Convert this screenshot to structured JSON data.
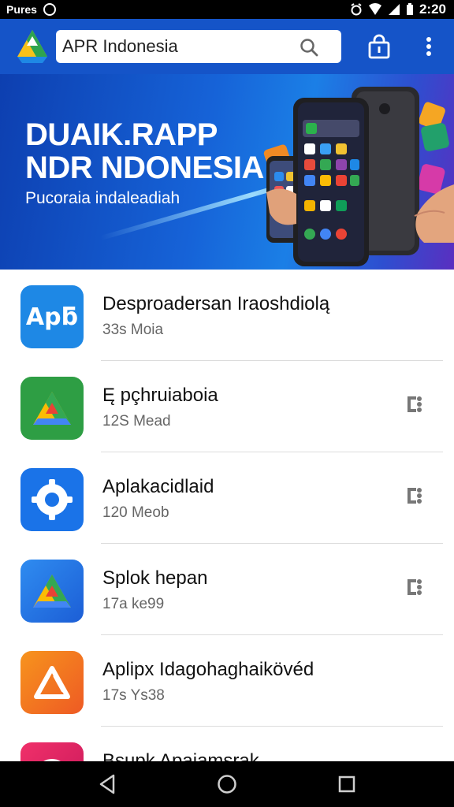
{
  "status_bar": {
    "carrier": "Pures",
    "time": "2:20"
  },
  "app_bar": {
    "search_value": "APR Indonesia",
    "colors": {
      "background": "#1554c8"
    }
  },
  "banner": {
    "title_line1": "DUAIK.RAPP",
    "title_line2": "NDR NDONESIA",
    "subtitle": "Pucoraia indaleadiah"
  },
  "apps": [
    {
      "title": "Desproadersan Iraoshdiolą",
      "subtitle": "33s Moia",
      "icon": "apk-icon",
      "icon_text": "Apƃ",
      "color": "#1e88e5",
      "has_action": false
    },
    {
      "title": "Ę pçhruiaboia",
      "subtitle": "12S Mead",
      "icon": "drive-triangle-icon",
      "color": "#2e9e44",
      "has_action": true
    },
    {
      "title": "Aplakacidlaid",
      "subtitle": "120 Meob",
      "icon": "gear-icon",
      "color": "#1a73e8",
      "has_action": true
    },
    {
      "title": "Splok hepan",
      "subtitle": "17a ke99",
      "icon": "drive-triangle-icon",
      "color": "#2a6ce0",
      "has_action": true
    },
    {
      "title": "Aplipx Idagohaghaikövéd",
      "subtitle": "17s Ys38",
      "icon": "triangle-outline-icon",
      "color": "#f06a1e",
      "has_action": false
    },
    {
      "title": "Bsupk Apaiamsrak",
      "subtitle": "",
      "icon": "ring-icon",
      "color": "#e8245c",
      "has_action": true
    }
  ]
}
